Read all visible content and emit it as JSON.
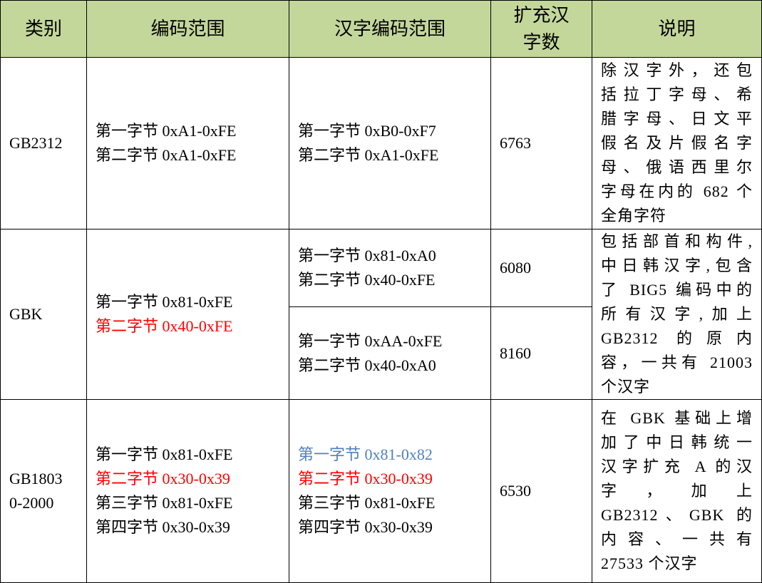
{
  "headers": {
    "category": "类别",
    "code_range": "编码范围",
    "hanzi_code_range": "汉字编码范围",
    "extended_count_line1": "扩充汉",
    "extended_count_line2": "字数",
    "description": "说明"
  },
  "rows": [
    {
      "category": "GB2312",
      "code_range": [
        "第一字节 0xA1-0xFE",
        "第二字节 0xA1-0xFE"
      ],
      "hanzi_range": [
        "第一字节 0xB0-0xF7",
        "第二字节 0xA1-0xFE"
      ],
      "count": "6763",
      "description": [
        "除汉字外，还包",
        "括拉丁字母、希",
        "腊字母、日文平",
        "假名及片假名字",
        "母、俄语西里尔",
        "字母在内的 682 个",
        "全角字符"
      ]
    },
    {
      "category": "GBK",
      "code_range": [
        "第一字节 0x81-0xFE",
        "第二字节 0x40-0xFE"
      ],
      "hanzi_range_a": [
        "第一字节 0x81-0xA0",
        "第二字节 0x40-0xFE"
      ],
      "count_a": "6080",
      "hanzi_range_b": [
        "第一字节 0xAA-0xFE",
        "第二字节 0x40-0xA0"
      ],
      "count_b": "8160",
      "description": [
        "包括部首和构件,",
        "中日韩汉字,包含",
        "了 BIG5 编码中的",
        "所有汉字,加上",
        "GB2312 的原内",
        "容，一共有 21003",
        "个汉字"
      ]
    },
    {
      "category_line1": "GB1803",
      "category_line2": "0-2000",
      "code_range": [
        "第一字节 0x81-0xFE",
        "第二字节 0x30-0x39",
        "第三字节 0x81-0xFE",
        "第四字节 0x30-0x39"
      ],
      "hanzi_range": [
        "第一字节 0x81-0x82",
        "第二字节 0x30-0x39",
        "第三字节 0x81-0xFE",
        "第四字节 0x30-0x39"
      ],
      "count": "6530",
      "description": [
        "在 GBK 基础上增",
        "加了中日韩统一",
        "汉字扩充 A 的汉",
        "字 ， 加 上",
        "GB2312、GBK 的",
        "内 容 、 一 共 有",
        "27533 个汉字"
      ]
    }
  ],
  "colors": {
    "header_bg": "#c4d79b",
    "highlight_red": "#ff0000",
    "highlight_blue": "#4f81bd"
  }
}
